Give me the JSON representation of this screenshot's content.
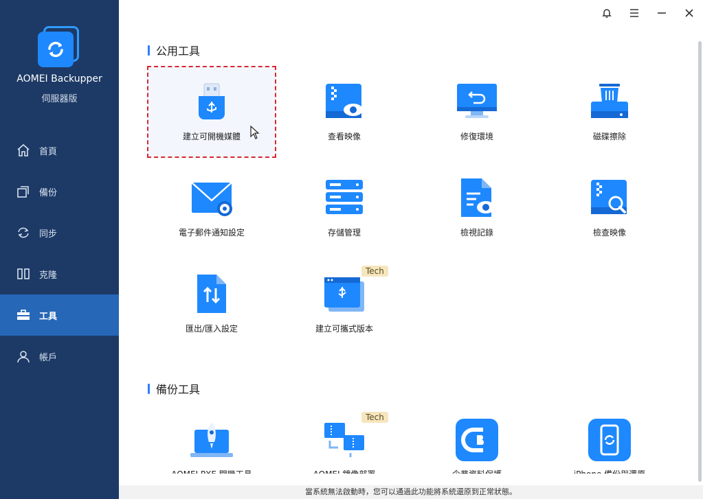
{
  "app": {
    "title": "AOMEI Backupper",
    "edition": "伺服器版"
  },
  "nav": [
    {
      "label": "首頁",
      "icon": "home-icon"
    },
    {
      "label": "備份",
      "icon": "backup-icon"
    },
    {
      "label": "同步",
      "icon": "sync-icon"
    },
    {
      "label": "克隆",
      "icon": "clone-icon"
    },
    {
      "label": "工具",
      "icon": "toolbox-icon",
      "active": true
    },
    {
      "label": "帳戶",
      "icon": "user-icon"
    }
  ],
  "sections": {
    "common": {
      "title": "公用工具"
    },
    "backup": {
      "title": "備份工具"
    }
  },
  "tools": {
    "create_bootable_media": "建立可開機媒體",
    "view_image": "查看映像",
    "recovery_env": "修復環境",
    "disk_wipe": "磁碟擦除",
    "email_settings": "電子郵件通知設定",
    "storage_management": "存儲管理",
    "view_logs": "檢視記錄",
    "check_image": "檢查映像",
    "export_import": "匯出/匯入設定",
    "create_portable": "建立可攜式版本",
    "pxe_tool": "AOMEI PXE 開機工具",
    "image_deploy": "AOMEI 鏡像部署",
    "cyber_backup": "企業資料保護",
    "iphone_backup": "iPhone 備份與還原"
  },
  "badges": {
    "tech": "Tech"
  },
  "statusbar": {
    "text": "當系統無法啟動時，您可以通過此功能將系統還原到正常狀態。"
  },
  "colors": {
    "sidebar": "#1d3a66",
    "active": "#2767b8",
    "accent": "#1e88ff",
    "selection_border": "#d9262e"
  }
}
